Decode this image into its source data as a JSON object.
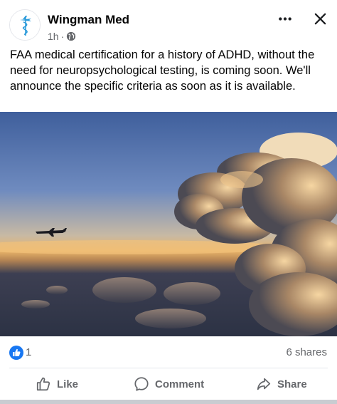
{
  "post": {
    "page_name": "Wingman Med",
    "time": "1h",
    "separator": "·",
    "text": "FAA medical certification for a history of ADHD, without the need for neuropsychological testing, is coming soon. We'll announce the specific criteria as soon as it is available."
  },
  "header": {
    "more_icon": "more-horizontal-icon",
    "close_icon": "close-icon",
    "privacy_icon": "globe-icon"
  },
  "photo": {
    "subject": "airplane flying at sunset beside a towering cumulus cloud"
  },
  "stats": {
    "reactions_count": "1",
    "shares": "6 shares"
  },
  "actions": {
    "like": "Like",
    "comment": "Comment",
    "share": "Share"
  },
  "colors": {
    "facebook_blue": "#1877f2",
    "secondary_text": "#65676b",
    "avatar_logo": "#2d9cdb"
  }
}
